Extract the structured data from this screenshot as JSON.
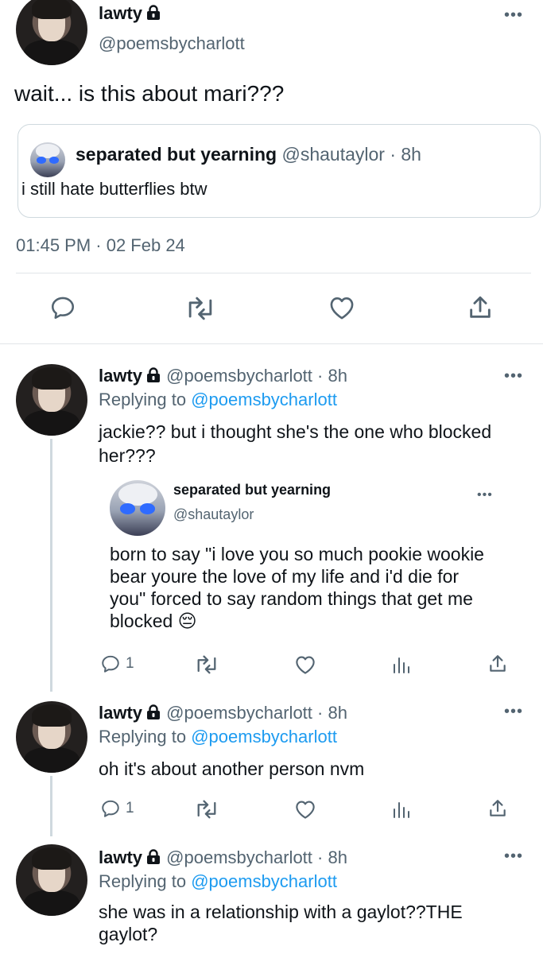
{
  "main_tweet": {
    "name": "lawty",
    "handle": "@poemsbycharlott",
    "text": "wait... is this about mari???",
    "quote": {
      "name": "separated but yearning",
      "handle": "@shautaylor",
      "time": "· 8h",
      "text": "i still hate butterflies btw"
    },
    "timestamp": "01:45 PM · 02 Feb 24"
  },
  "replies": [
    {
      "name": "lawty",
      "handle": "@poemsbycharlott",
      "time": "· 8h",
      "replying_prefix": "Replying to",
      "replying_to": "@poemsbycharlott",
      "text_line1": "jackie?? but i thought she's the one who blocked",
      "text_line2": "her???",
      "quote": {
        "name": "separated but yearning",
        "handle": "@shautaylor",
        "text_line1": "born to say \"i love you so much pookie wookie",
        "text_line2": "bear youre the love of my life and i'd die for",
        "text_line3": "you\" forced to say random things that get me",
        "text_line4": "blocked",
        "emoji": "😔"
      },
      "reply_count": "1"
    },
    {
      "name": "lawty",
      "handle": "@poemsbycharlott",
      "time": "· 8h",
      "replying_prefix": "Replying to",
      "replying_to": "@poemsbycharlott",
      "text": "oh it's about another person nvm",
      "reply_count": "1"
    },
    {
      "name": "lawty",
      "handle": "@poemsbycharlott",
      "time": "· 8h",
      "replying_prefix": "Replying to",
      "replying_to": "@poemsbycharlott",
      "text_line1": "she was in a relationship with a gaylot??THE",
      "text_line2": "gaylot?"
    }
  ],
  "more_label": "•••",
  "colors": {
    "accent": "#1d9bf0",
    "secondary_text": "#536471",
    "divider": "#e1e5e8"
  },
  "icons": [
    "reply-icon",
    "retweet-icon",
    "like-icon",
    "views-icon",
    "share-icon",
    "lock-icon",
    "more-icon"
  ]
}
